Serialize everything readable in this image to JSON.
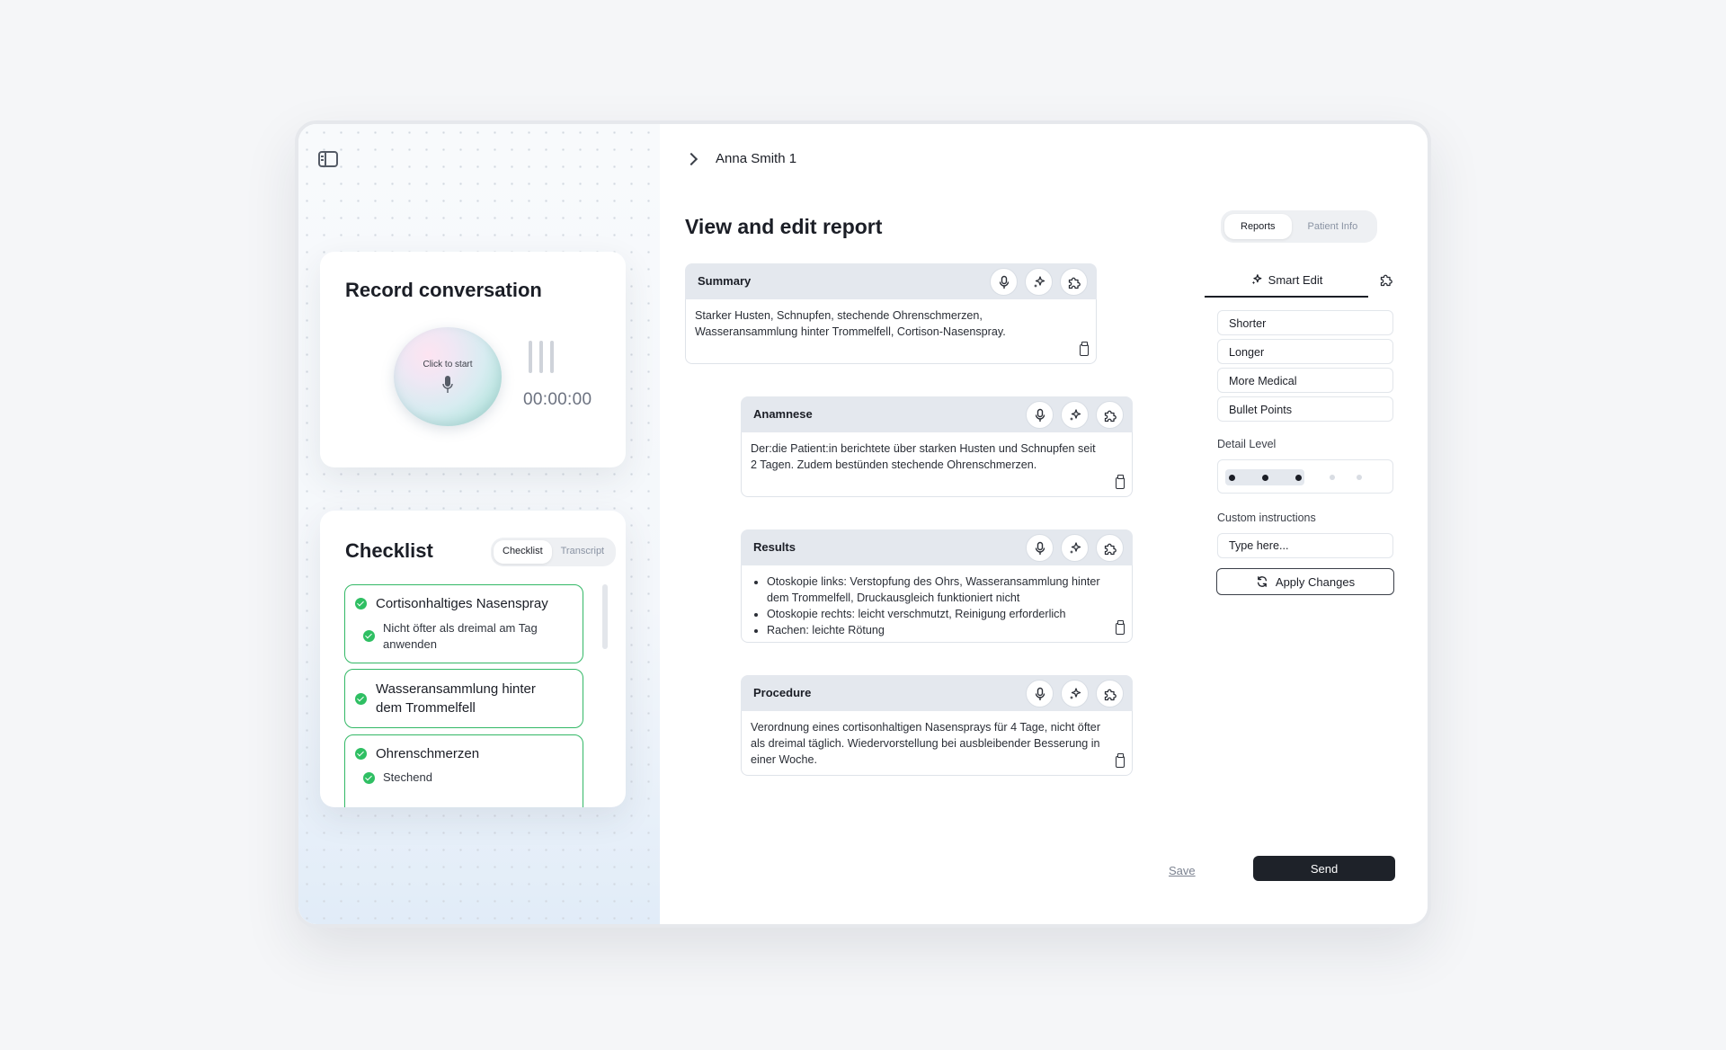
{
  "record": {
    "title": "Record conversation",
    "orb_label": "Click to start",
    "timer": "00:00:00"
  },
  "checklist": {
    "title": "Checklist",
    "tabs": [
      "Checklist",
      "Transcript"
    ],
    "active_tab": "Checklist",
    "items": [
      {
        "title": "Cortisonhaltiges Nasenspray",
        "sub": "Nicht öfter als dreimal am Tag anwenden"
      },
      {
        "title": "Wasseransammlung hinter dem Trommelfell"
      },
      {
        "title": "Ohrenschmerzen",
        "sub": "Stechend"
      }
    ]
  },
  "header": {
    "breadcrumb": "Anna Smith 1",
    "title": "View and edit report",
    "tabs": [
      "Reports",
      "Patient Info"
    ],
    "active_tab": "Reports"
  },
  "sections": [
    {
      "label": "Summary",
      "text": "Starker Husten, Schnupfen, stechende Ohrenschmerzen, Wasseransammlung hinter Trommelfell, Cortison-Nasenspray."
    },
    {
      "label": "Anamnese",
      "text": "Der:die Patient:in berichtete über starken Husten und Schnupfen seit 2 Tagen. Zudem bestünden stechende Ohrenschmerzen."
    },
    {
      "label": "Results",
      "bullets": [
        "Otoskopie links: Verstopfung des Ohrs, Wasseransammlung hinter dem Trommelfell, Druckausgleich funktioniert nicht",
        "Otoskopie rechts: leicht verschmutzt, Reinigung erforderlich",
        "Rachen: leichte Rötung"
      ]
    },
    {
      "label": "Procedure",
      "text": "Verordnung eines cortisonhaltigen Nasensprays für 4 Tage, nicht öfter als dreimal täglich. Wiedervorstellung bei ausbleibender Besserung in einer Woche."
    }
  ],
  "smart_edit": {
    "tab_label": "Smart Edit",
    "options": [
      "Shorter",
      "Longer",
      "More Medical",
      "Bullet Points"
    ],
    "detail_label": "Detail Level",
    "detail_value": 3,
    "detail_max": 5,
    "custom_label": "Custom instructions",
    "custom_placeholder": "Type here...",
    "apply_label": "Apply Changes"
  },
  "footer": {
    "save_label": "Save",
    "send_label": "Send"
  },
  "colors": {
    "accent_green": "#2fbf63",
    "section_header": "#e4e8ee",
    "primary_dark": "#1e2229"
  }
}
